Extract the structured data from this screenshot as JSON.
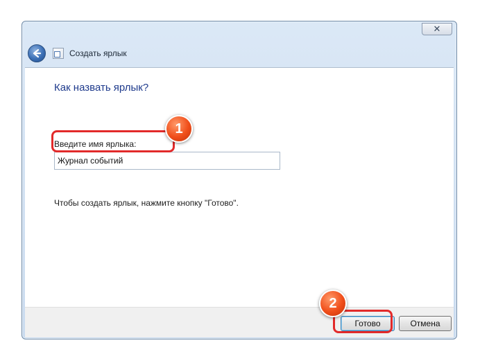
{
  "window": {
    "title": "Создать ярлык",
    "close_symbol": "✕"
  },
  "icons": {
    "back": "back-arrow-icon",
    "shortcut": "shortcut-icon"
  },
  "main": {
    "heading": "Как назвать ярлык?",
    "name_label": "Введите имя ярлыка:",
    "name_value": "Журнал событий",
    "hint": "Чтобы создать ярлык, нажмите кнопку \"Готово\"."
  },
  "buttons": {
    "done": "Готово",
    "cancel": "Отмена"
  },
  "annotations": {
    "marker_1": "1",
    "marker_2": "2"
  },
  "colors": {
    "heading": "#1e3a8c",
    "highlight": "#e22a2a",
    "marker": "#f04e1a"
  }
}
